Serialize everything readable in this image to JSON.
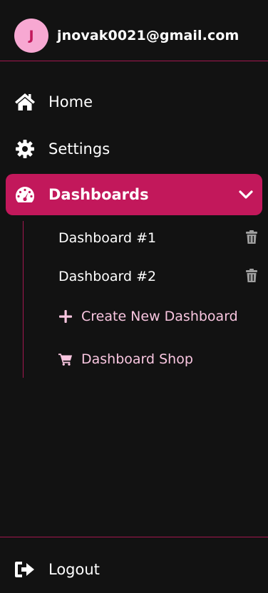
{
  "user": {
    "avatar_initial": "J",
    "email": "jnovak0021@gmail.com"
  },
  "nav": {
    "home_label": "Home",
    "settings_label": "Settings",
    "dashboards_label": "Dashboards"
  },
  "dashboards": {
    "items": [
      {
        "label": "Dashboard #1"
      },
      {
        "label": "Dashboard #2"
      }
    ],
    "create_label": "Create New Dashboard",
    "shop_label": "Dashboard Shop"
  },
  "footer": {
    "logout_label": "Logout"
  },
  "icons": {
    "home": "home-icon",
    "settings": "gear-icon",
    "dashboards": "gauge-icon",
    "chevron": "chevron-down-icon",
    "trash": "trash-icon",
    "plus": "plus-icon",
    "cart": "cart-icon",
    "logout": "logout-icon"
  },
  "colors": {
    "background": "#121212",
    "accent": "#c2185b",
    "divider": "#a3174f",
    "avatar_bg": "#f7a8d2",
    "action_text": "#f9c6e0",
    "trash": "#9e9e9e"
  }
}
